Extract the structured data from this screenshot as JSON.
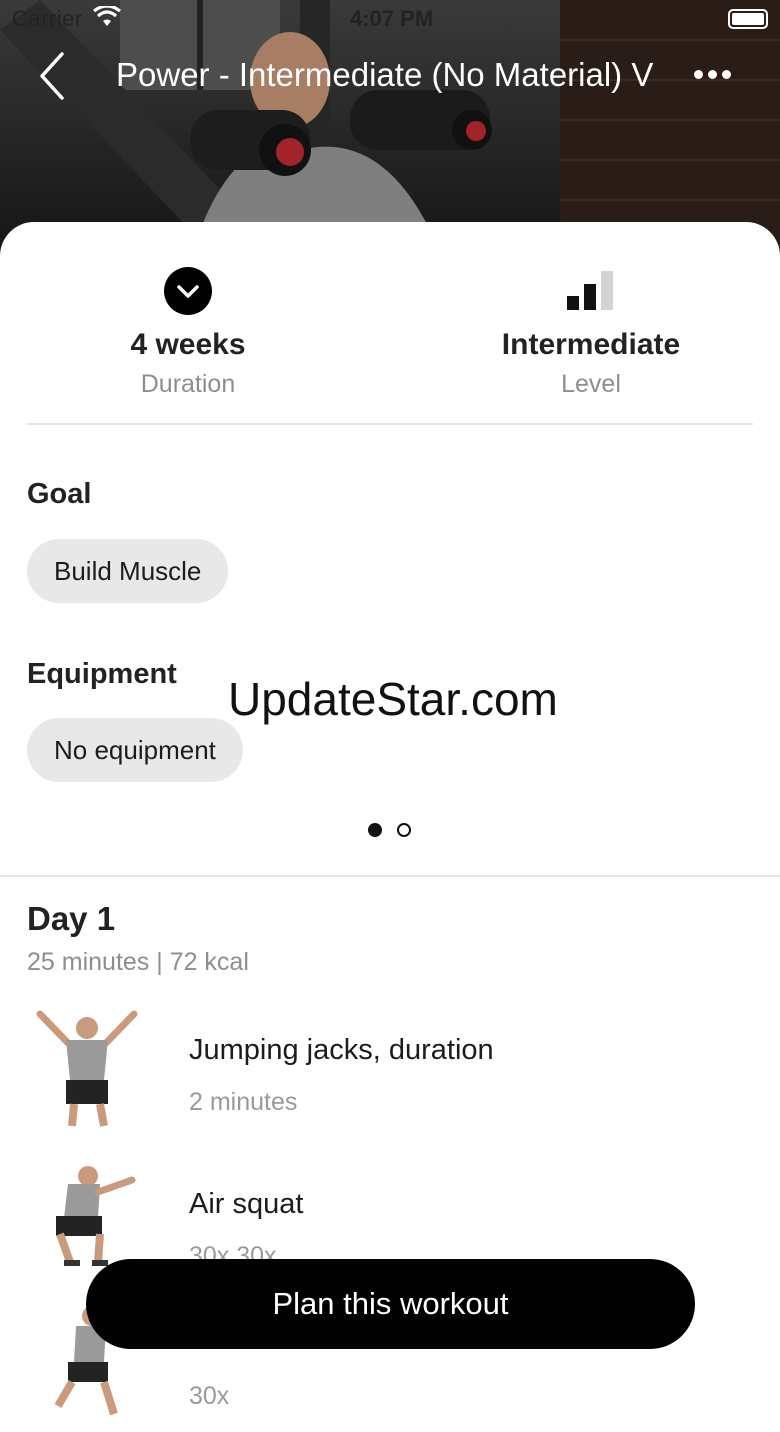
{
  "status_bar": {
    "carrier": "Carrier",
    "time": "4:07 PM"
  },
  "nav": {
    "title": "Power - Intermediate (No Material) V"
  },
  "stats": {
    "duration": {
      "value": "4 weeks",
      "caption": "Duration",
      "icon": "chevron-down-circle-icon"
    },
    "level": {
      "value": "Intermediate",
      "caption": "Level",
      "icon": "signal-bars-icon",
      "filled_bars": 2,
      "total_bars": 3
    }
  },
  "goal": {
    "label": "Goal",
    "chip": "Build Muscle"
  },
  "equipment": {
    "label": "Equipment",
    "chip": "No equipment"
  },
  "watermark": "UpdateStar.com",
  "pager": {
    "current_page": 1,
    "total_pages": 2
  },
  "day": {
    "title": "Day 1",
    "meta": "25 minutes | 72 kcal",
    "exercises": [
      {
        "name": "Jumping jacks, duration",
        "detail": "2 minutes"
      },
      {
        "name": "Air squat",
        "detail": "30x 30x"
      },
      {
        "name": "",
        "detail": "30x"
      }
    ]
  },
  "cta": {
    "label": "Plan this workout"
  },
  "colors": {
    "accent": "#000000",
    "chip_bg": "#e8e8e8",
    "muted_text": "#8e8e8e"
  }
}
